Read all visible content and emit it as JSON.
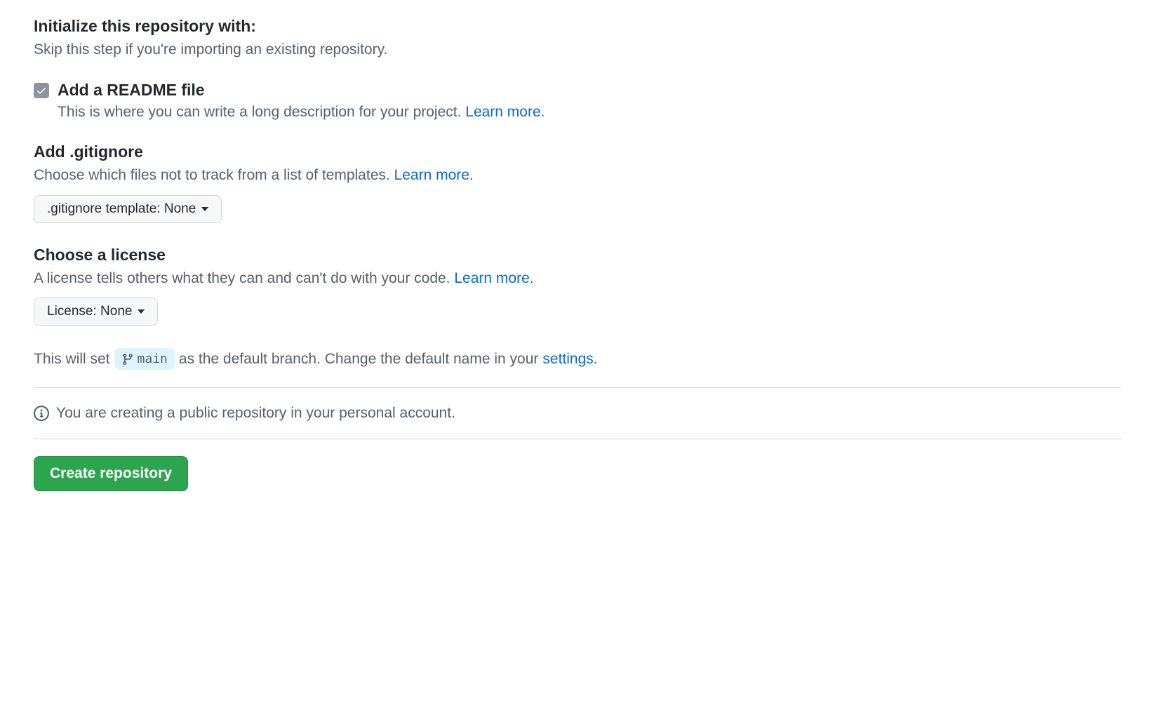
{
  "initialize": {
    "heading": "Initialize this repository with:",
    "description": "Skip this step if you're importing an existing repository."
  },
  "readme": {
    "label": "Add a README file",
    "description": "This is where you can write a long description for your project. ",
    "learn_more": "Learn more."
  },
  "gitignore": {
    "heading": "Add .gitignore",
    "description": "Choose which files not to track from a list of templates. ",
    "learn_more": "Learn more.",
    "dropdown_label": ".gitignore template: None"
  },
  "license": {
    "heading": "Choose a license",
    "description": "A license tells others what they can and can't do with your code. ",
    "learn_more": "Learn more.",
    "dropdown_label": "License: None"
  },
  "branch": {
    "prefix": "This will set ",
    "branch_name": "main",
    "middle": " as the default branch. Change the default name in your ",
    "settings_link": "settings",
    "suffix": "."
  },
  "notice": "You are creating a public repository in your personal account.",
  "create_button": "Create repository"
}
